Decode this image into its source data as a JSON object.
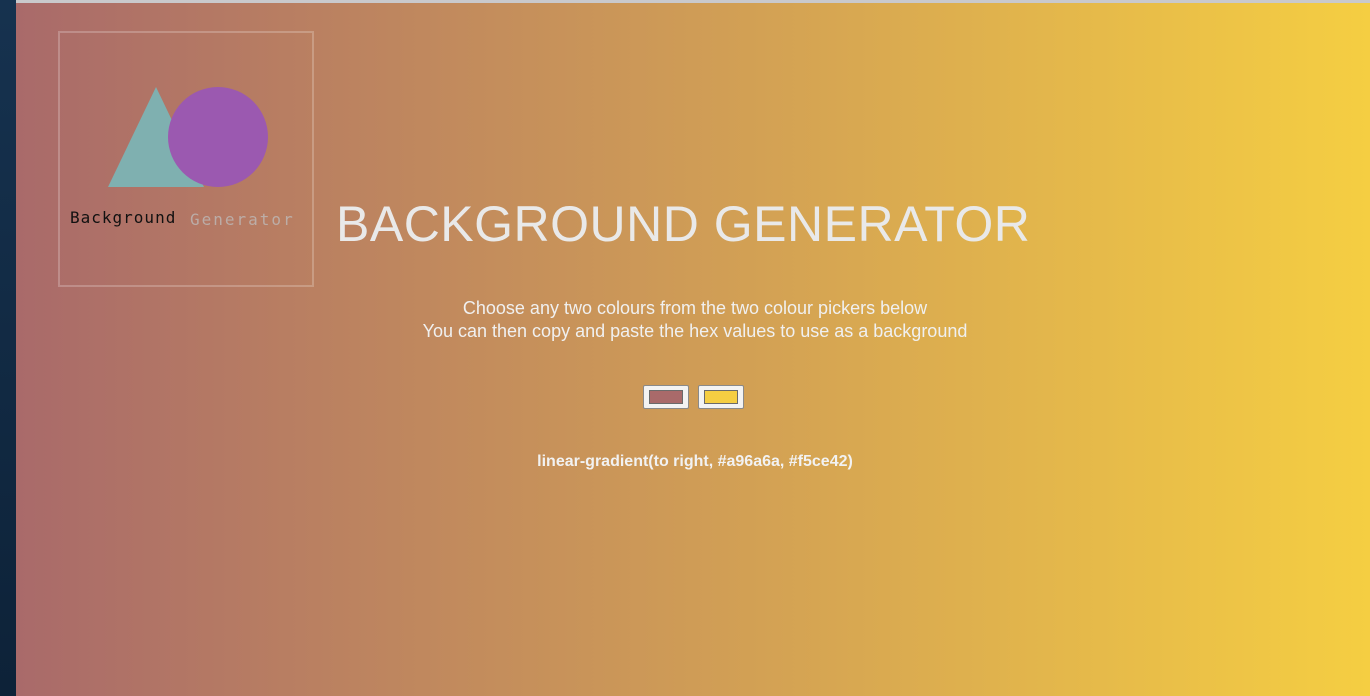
{
  "logo": {
    "word_primary": "Background",
    "word_secondary": "Generator",
    "triangle_color": "#7fb0b0",
    "circle_color": "#9b59b0"
  },
  "title": "BACKGROUND GENERATOR",
  "intro": {
    "line1": "Choose any two colours from the two colour pickers below",
    "line2": "You can then copy and paste the hex values to use as a background"
  },
  "pickers": {
    "color1": "#a96a6a",
    "color2": "#f5ce42"
  },
  "gradient_css": "linear-gradient(to right, #a96a6a, #f5ce42)",
  "background_colors": [
    "#a96a6a",
    "#f5ce42"
  ]
}
